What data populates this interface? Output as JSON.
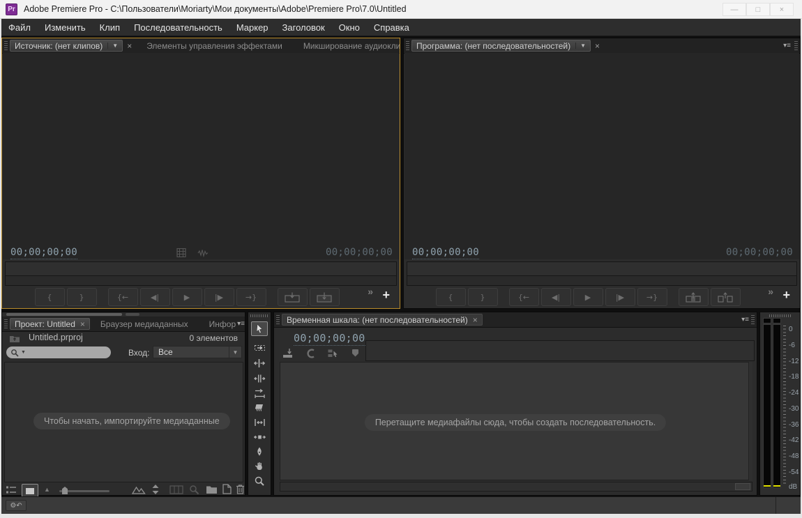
{
  "window": {
    "logo_text": "Pr",
    "title": "Adobe Premiere Pro - C:\\Пользователи\\Moriarty\\Мои документы\\Adobe\\Premiere Pro\\7.0\\Untitled"
  },
  "icons": {
    "minimize": "—",
    "maximize": "□",
    "close": "×",
    "tab_close": "×",
    "dropdown": "▼",
    "panel_menu": "▾≡",
    "chevron_more": "»",
    "add": "+",
    "settings_undo": "⚙↶",
    "view_triangle": "▲"
  },
  "menu": {
    "items": [
      "Файл",
      "Изменить",
      "Клип",
      "Последовательность",
      "Маркер",
      "Заголовок",
      "Окно",
      "Справка"
    ]
  },
  "source_monitor": {
    "tabs": {
      "source": "Источник: (нет клипов)",
      "effects": "Элементы управления эффектами",
      "audio_mixer": "Микширование аудиокли"
    },
    "timecode_current": "00;00;00;00",
    "timecode_duration": "00;00;00;00"
  },
  "program_monitor": {
    "tab": "Программа: (нет последовательностей)",
    "timecode_current": "00;00;00;00",
    "timecode_duration": "00;00;00;00"
  },
  "transport": {
    "mark_in": "{",
    "mark_out": "}",
    "go_to_in": "{←",
    "step_back": "◀|",
    "play": "▶",
    "step_forward": "|▶",
    "go_to_out": "→}"
  },
  "project_panel": {
    "tabs": {
      "project": "Проект: Untitled",
      "media_browser": "Браузер медиаданных",
      "info": "Инфор"
    },
    "file_name": "Untitled.prproj",
    "item_count": "0 элементов",
    "filter_label": "Вход:",
    "filter_value": "Все",
    "empty_message": "Чтобы начать, импортируйте медиаданные"
  },
  "timeline_panel": {
    "tab": "Временная шкала: (нет последовательностей)",
    "timecode": "00;00;00;00",
    "empty_message": "Перетащите медиафайлы сюда, чтобы создать последовательность."
  },
  "audio_meters": {
    "ticks": [
      "0",
      "-6",
      "-12",
      "-18",
      "-24",
      "-30",
      "-36",
      "-42",
      "-48",
      "-54"
    ],
    "unit": "dB"
  },
  "colors": {
    "focus_border": "#b98c2b",
    "clip_indicator": "#e6e600",
    "logo_purple": "#7e2c94"
  }
}
